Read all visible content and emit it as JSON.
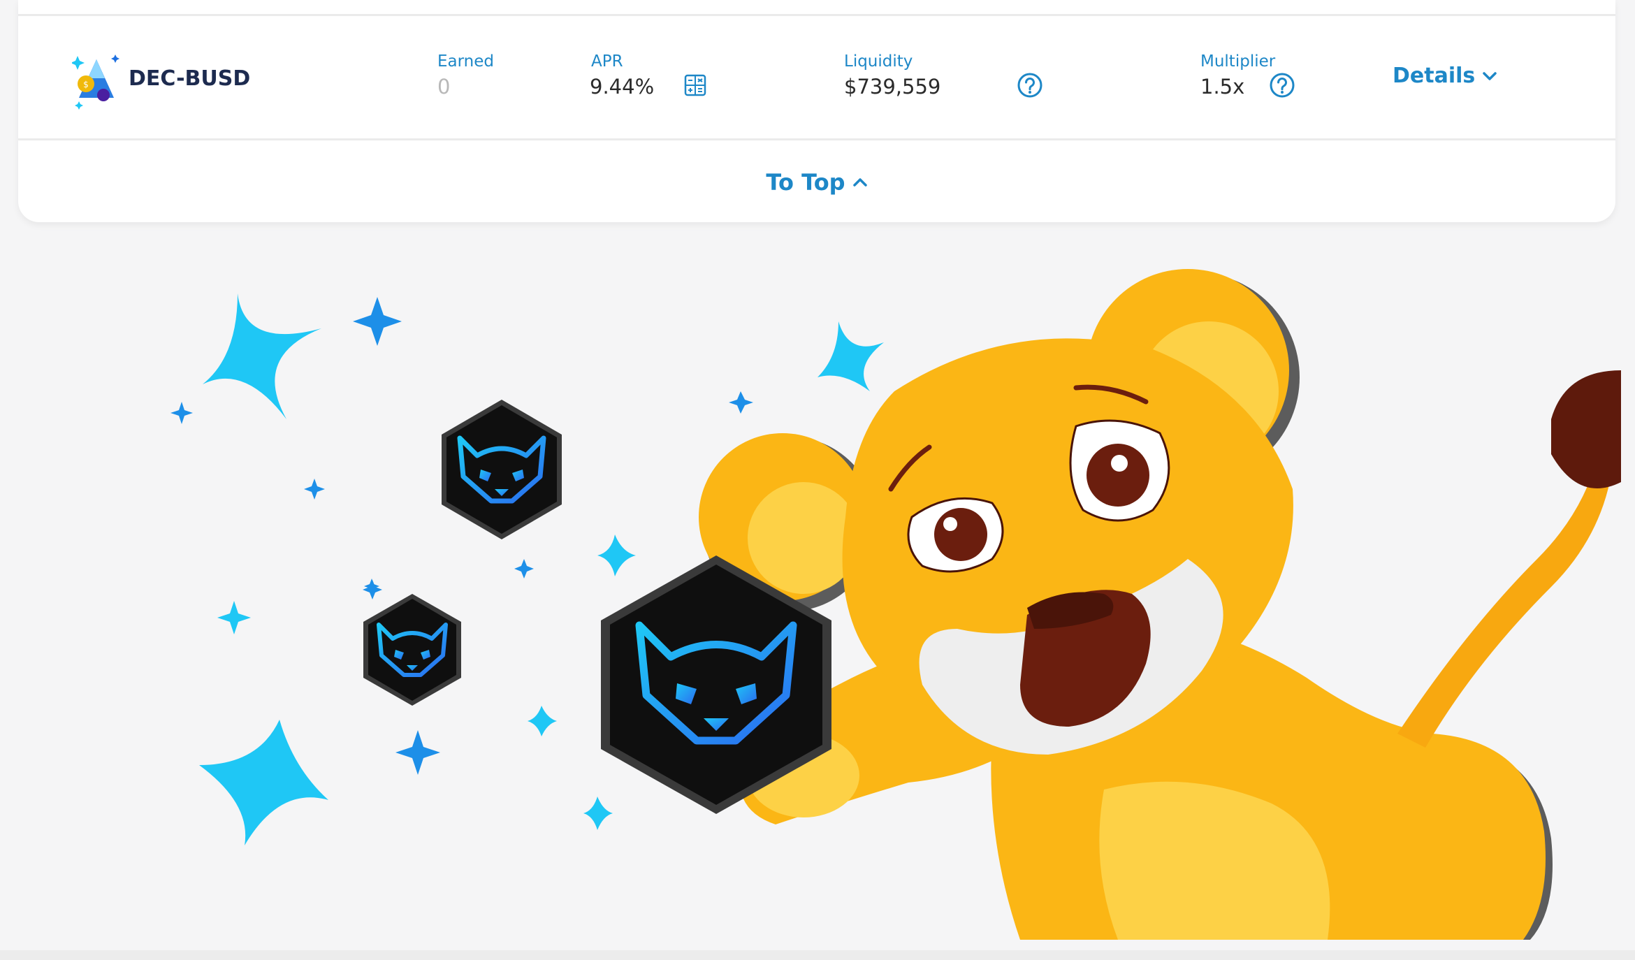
{
  "farm": {
    "pair_name": "DEC-BUSD",
    "token_icon": "dec-busd-token-icon",
    "earned": {
      "label": "Earned",
      "value": "0"
    },
    "apr": {
      "label": "APR",
      "value": "9.44%",
      "icon": "calculator-icon"
    },
    "liquidity": {
      "label": "Liquidity",
      "value": "$739,559",
      "icon": "question-circle-icon"
    },
    "multiplier": {
      "label": "Multiplier",
      "value": "1.5x",
      "icon": "question-circle-icon"
    },
    "details_label": "Details",
    "details_icon": "chevron-down-icon"
  },
  "footer": {
    "to_top_label": "To Top",
    "to_top_icon": "chevron-up-icon"
  },
  "illustration": {
    "name": "lion-cub-with-tokens"
  },
  "colors": {
    "accent": "#1d87c7",
    "sparkle": "#1fc7f5",
    "lion": "#fbb615",
    "background": "#f5f5f6"
  }
}
